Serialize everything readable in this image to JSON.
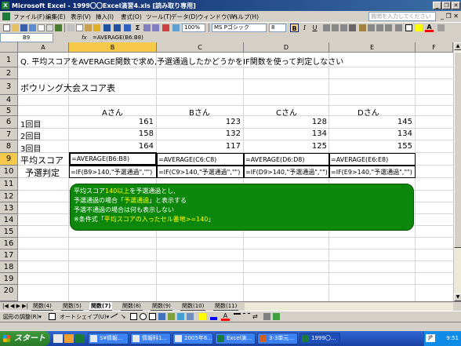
{
  "window": {
    "title": "Microsoft Excel - 1999〇〇Excel演習4.xls [読み取り専用]",
    "buttons": {
      "minimize": "_",
      "restore": "❐",
      "close": "✕"
    }
  },
  "menu": {
    "items": [
      "ファイル(F)",
      "編集(E)",
      "表示(V)",
      "挿入(I)",
      "書式(O)",
      "ツール(T)",
      "データ(D)",
      "ウィンドウ(W)",
      "ヘルプ(H)"
    ],
    "help_placeholder": "質問を入力してください",
    "window_buttons": "_ ❐ ✕"
  },
  "toolbar": {
    "font_name": "MS Pゴシック",
    "font_size": "8",
    "bold": "B",
    "italic": "I",
    "underline": "U",
    "colors": {
      "highlight": "#ffd88a",
      "fill": "#ffff00",
      "font": "#ff0000"
    }
  },
  "formula_bar": {
    "name_box": "B9",
    "fx": "fx",
    "formula": "=AVERAGE(B6:B8)"
  },
  "columns": [
    "A",
    "B",
    "C",
    "D",
    "E",
    "F"
  ],
  "rows": [
    "1",
    "2",
    "3",
    "4",
    "5",
    "6",
    "7",
    "8",
    "9",
    "10",
    "11",
    "12",
    "13",
    "14",
    "15",
    "16",
    "17",
    "18",
    "19",
    "20"
  ],
  "sheet": {
    "a1": "Q. 平均スコアをAVERAGE関数で求め,予選通過したかどうかをIF関数を使って判定しなさい",
    "a3": "ボウリング大会スコア表",
    "headers": [
      "Aさん",
      "Bさん",
      "Cさん",
      "Dさん"
    ],
    "round_labels": [
      "1回目",
      "2回目",
      "3回目"
    ],
    "scores": [
      [
        "161",
        "123",
        "128",
        "145"
      ],
      [
        "158",
        "132",
        "134",
        "134"
      ],
      [
        "164",
        "117",
        "125",
        "155"
      ]
    ],
    "avg_label": "平均スコア",
    "judge_label": "予選判定",
    "avg_formulas": [
      "=AVERAGE(B6:B8)",
      "=AVERAGE(C6:C8)",
      "=AVERAGE(D6:D8)",
      "=AVERAGE(E6:E8)"
    ],
    "if_formulas": [
      "=IF(B9>140,\"予選通過\",\"\")",
      "=IF(C9>140,\"予選通過\",\"\")",
      "=IF(D9>140,\"予選通過\",\"\")",
      "=IF(E9>140,\"予選通過\",\"\")"
    ]
  },
  "note": {
    "line1_a": "平均スコア",
    "line1_b": "140以上",
    "line1_c": "を予選通過とし,",
    "line2_a": "予選通過の場合「",
    "line2_b": "予選通過",
    "line2_c": "」と表示する",
    "line3": "予選不通過の場合は何も表示しない",
    "line4_a": "※条件式「",
    "line4_b": "平均スコアの入ったセル番地>=140",
    "line4_c": "」"
  },
  "tabs": {
    "nav": "|◀ ◀ ▶ ▶|",
    "items": [
      "関数(4)",
      "関数(5)",
      "関数(7)",
      "関数(8)",
      "関数(9)",
      "関数(10)",
      "関数(11)"
    ],
    "active_index": 2
  },
  "drawbar": {
    "draw_menu": "図形の調整(R)▾",
    "autoshape": "オートシェイプ(U)▾"
  },
  "status": {
    "left": ""
  },
  "taskbar": {
    "start": "スタート",
    "tasks": [
      "S¥情報...",
      "情報科1...",
      "2005年6...",
      "Excel演...",
      "3-3単元...",
      "1999〇..."
    ],
    "tray_badge": "JP",
    "clock": "9:51"
  }
}
